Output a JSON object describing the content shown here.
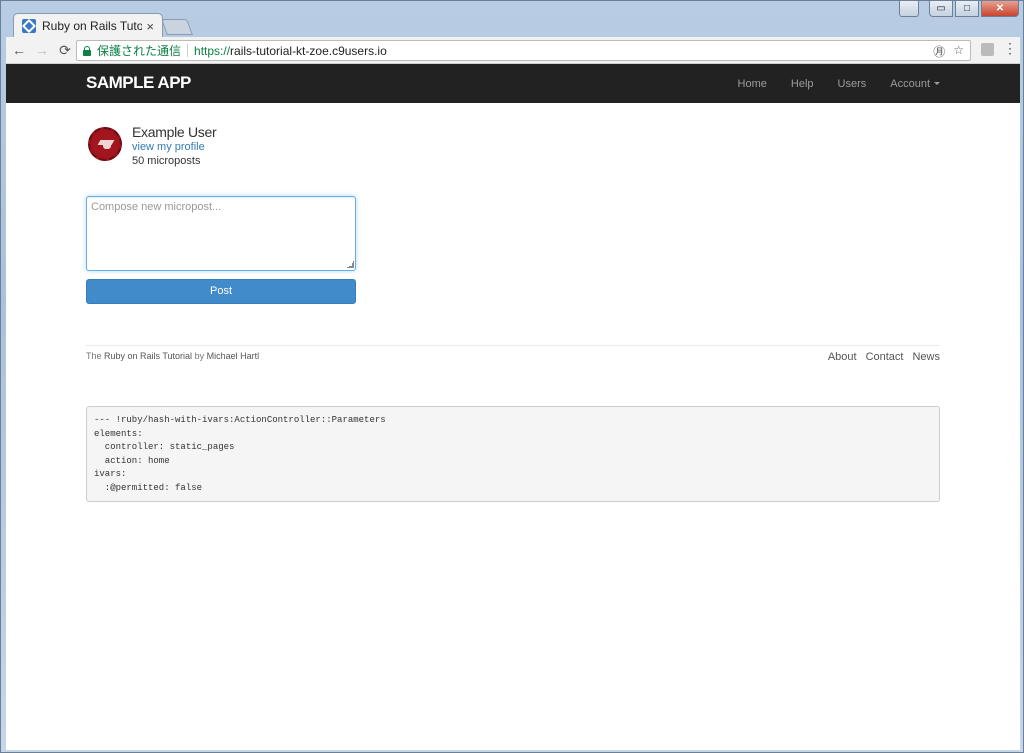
{
  "browser": {
    "tab_title": "Ruby on Rails Tutorial",
    "tab_close": "×",
    "secure_label": "保護された通信",
    "url_scheme": "https://",
    "url_host": "rails-tutorial-kt-zoe.c9users.io",
    "window_controls": {
      "minimize": "▭",
      "maximize": "□",
      "close": "✕"
    }
  },
  "navbar": {
    "brand": "sample app",
    "links": {
      "home": "Home",
      "help": "Help",
      "users": "Users",
      "account": "Account"
    }
  },
  "user": {
    "name": "Example User",
    "profile_link": "view my profile",
    "microposts": "50 microposts"
  },
  "composer": {
    "placeholder": "Compose new micropost...",
    "post_label": "Post"
  },
  "footer": {
    "credit_prefix": "The ",
    "credit_link": "Ruby on Rails Tutorial",
    "credit_by": " by ",
    "credit_author": "Michael Hartl",
    "links": {
      "about": "About",
      "contact": "Contact",
      "news": "News"
    }
  },
  "debug": {
    "text": "--- !ruby/hash-with-ivars:ActionController::Parameters\nelements:\n  controller: static_pages\n  action: home\nivars:\n  :@permitted: false"
  },
  "colors": {
    "navbar_bg": "#222222",
    "primary": "#428bca",
    "link": "#337ab7",
    "secure_green": "#0b8043"
  }
}
